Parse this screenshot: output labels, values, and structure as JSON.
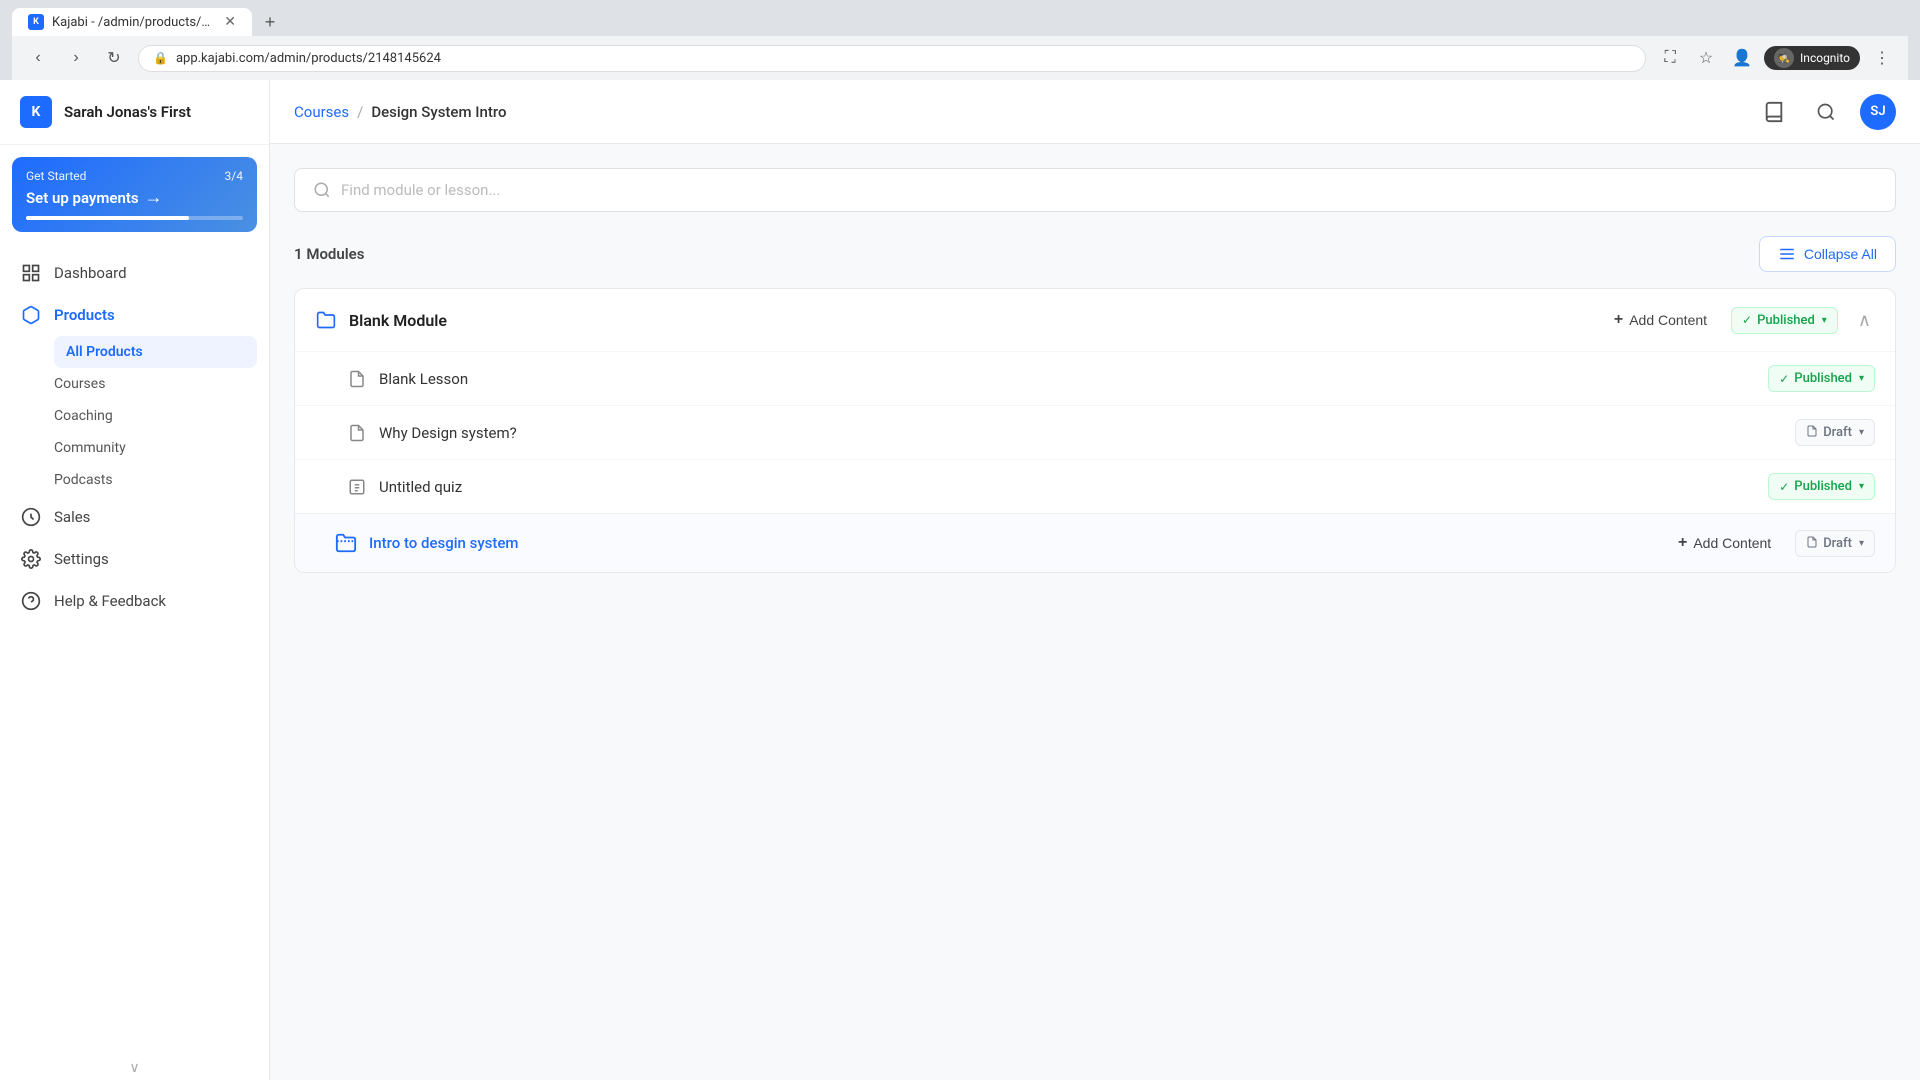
{
  "browser": {
    "tab_title": "Kajabi - /admin/products/21481...",
    "tab_favicon": "K",
    "new_tab_tooltip": "New tab",
    "url": "app.kajabi.com/admin/products/2148145624",
    "incognito_label": "Incognito"
  },
  "sidebar": {
    "logo_text": "K",
    "brand": "Sarah Jonas's First",
    "get_started": {
      "label": "Get Started",
      "progress_text": "3/4",
      "title": "Set up payments",
      "arrow": "→"
    },
    "nav_items": [
      {
        "id": "dashboard",
        "label": "Dashboard",
        "icon": "dashboard"
      },
      {
        "id": "products",
        "label": "Products",
        "icon": "products",
        "active": true,
        "sub_items": [
          {
            "id": "all-products",
            "label": "All Products",
            "active": true
          },
          {
            "id": "courses",
            "label": "Courses"
          },
          {
            "id": "coaching",
            "label": "Coaching"
          },
          {
            "id": "community",
            "label": "Community"
          },
          {
            "id": "podcasts",
            "label": "Podcasts"
          }
        ]
      },
      {
        "id": "sales",
        "label": "Sales",
        "icon": "sales"
      },
      {
        "id": "settings",
        "label": "Settings",
        "icon": "settings"
      },
      {
        "id": "help",
        "label": "Help & Feedback",
        "icon": "help"
      }
    ]
  },
  "topbar": {
    "breadcrumb_parent": "Courses",
    "breadcrumb_sep": "/",
    "breadcrumb_current": "Design System Intro",
    "user_initials": "SJ"
  },
  "search": {
    "placeholder": "Find module or lesson..."
  },
  "modules_section": {
    "count_prefix": "1",
    "count_label": "Modules",
    "collapse_all_label": "Collapse All"
  },
  "modules": [
    {
      "id": "blank-module",
      "title": "Blank Module",
      "icon_type": "folder",
      "add_content_label": "+ Add Content",
      "status": "published",
      "status_label": "Published",
      "expanded": true,
      "lessons": [
        {
          "id": "blank-lesson",
          "title": "Blank Lesson",
          "icon_type": "doc",
          "status": "published",
          "status_label": "Published"
        },
        {
          "id": "why-design",
          "title": "Why Design system?",
          "icon_type": "doc",
          "status": "draft",
          "status_label": "Draft"
        },
        {
          "id": "untitled-quiz",
          "title": "Untitled quiz",
          "icon_type": "quiz",
          "status": "published",
          "status_label": "Published"
        }
      ],
      "sub_modules": [
        {
          "id": "intro-to-design",
          "title": "Intro to desgin system",
          "icon_type": "sub-folder",
          "add_content_label": "+ Add Content",
          "status": "draft",
          "status_label": "Draft"
        }
      ]
    }
  ],
  "icons": {
    "search": "🔍",
    "collapse": "≡",
    "folder": "📁",
    "doc": "📄",
    "quiz": "📋",
    "check": "✓",
    "draft_doc": "📄",
    "chevron_down": "▾",
    "chevron_up": "∧",
    "book": "📖",
    "search_nav": "🔍",
    "dashboard_icon": "⊞",
    "products_icon": "◈",
    "sales_icon": "◑",
    "settings_icon": "⚙",
    "help_icon": "?",
    "sub_module_icon": "◫"
  }
}
